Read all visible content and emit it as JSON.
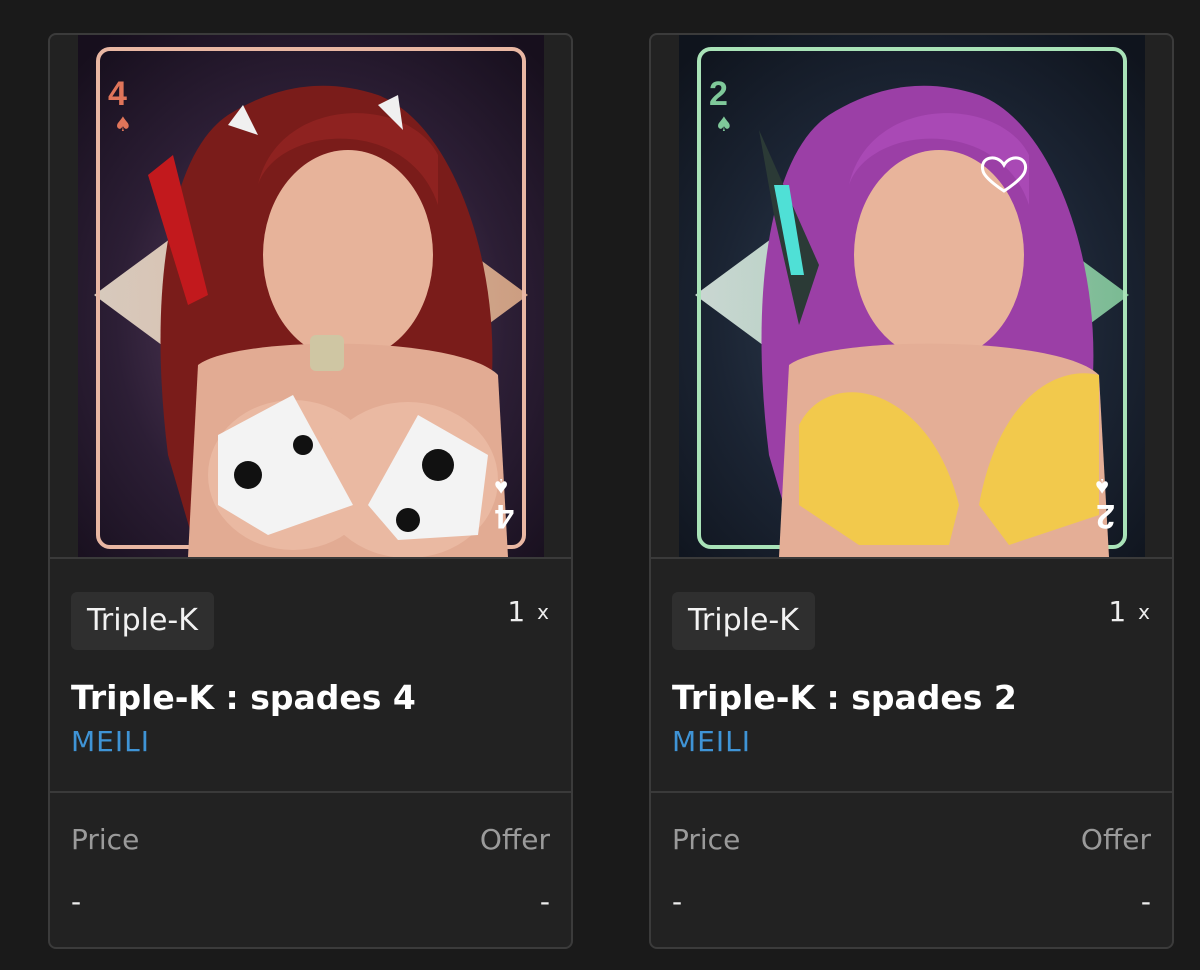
{
  "cards": [
    {
      "image": "card-art-spades-4",
      "card_rank": "4",
      "tag": "Triple-K",
      "quantity": "1",
      "quantity_suffix": "x",
      "title": "Triple-K : spades 4",
      "creator": "MEILI",
      "price_label": "Price",
      "offer_label": "Offer",
      "price_value": "-",
      "offer_value": "-",
      "accent_color": "#e0755a",
      "border_color": "#e9b7a3"
    },
    {
      "image": "card-art-spades-2",
      "card_rank": "2",
      "tag": "Triple-K",
      "quantity": "1",
      "quantity_suffix": "x",
      "title": "Triple-K : spades 2",
      "creator": "MEILI",
      "price_label": "Price",
      "offer_label": "Offer",
      "price_value": "-",
      "offer_value": "-",
      "accent_color": "#7fc99a",
      "border_color": "#a9e3b8"
    }
  ]
}
